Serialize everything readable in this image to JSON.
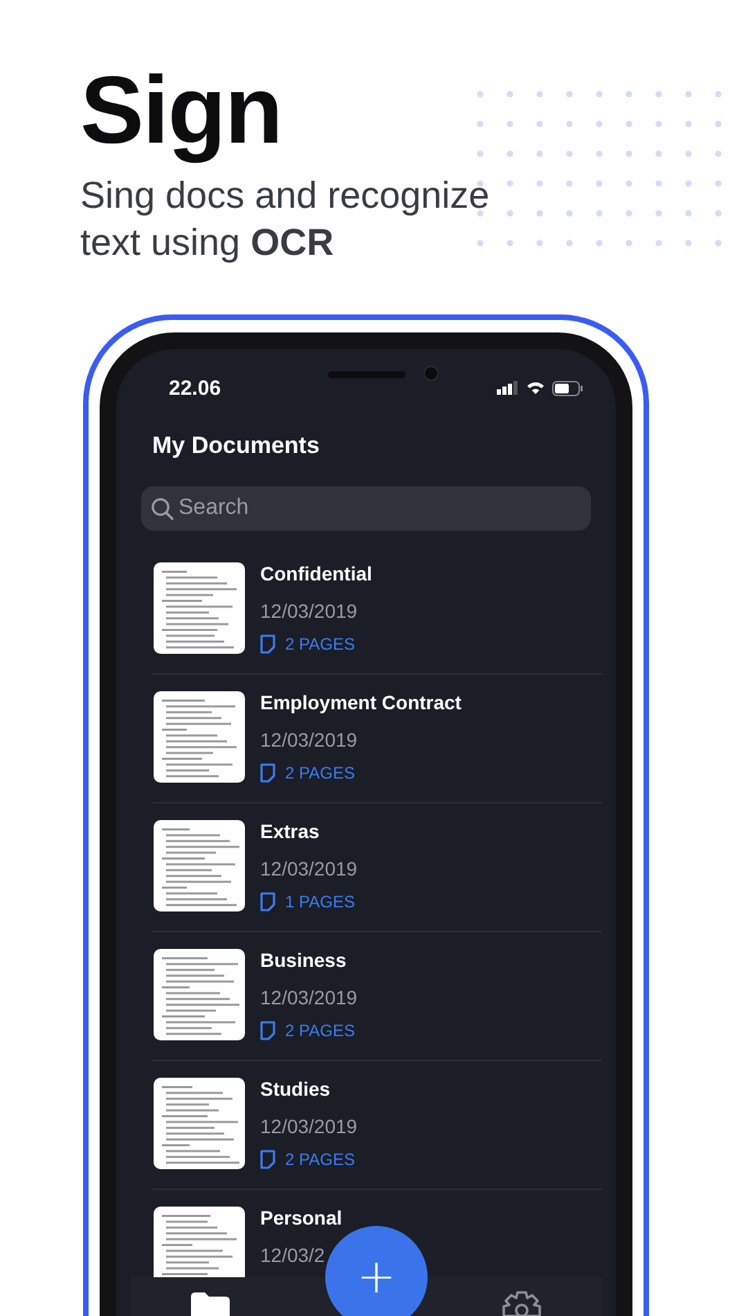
{
  "headline": {
    "title": "Sign",
    "subtitle": "Sing docs and recognize text using **OCR**"
  },
  "phone": {
    "status_bar": {
      "time": "22.06"
    },
    "screen_title": "My Documents",
    "search": {
      "placeholder": "Search"
    },
    "documents": [
      {
        "name": "Confidential",
        "date": "12/03/2019",
        "pages": "2 PAGES"
      },
      {
        "name": "Employment Contract",
        "date": "12/03/2019",
        "pages": "2 PAGES"
      },
      {
        "name": "Extras",
        "date": "12/03/2019",
        "pages": "1 PAGES"
      },
      {
        "name": "Business",
        "date": "12/03/2019",
        "pages": "2 PAGES"
      },
      {
        "name": "Studies",
        "date": "12/03/2019",
        "pages": "2 PAGES"
      },
      {
        "name": "Personal",
        "date": "12/03/2"
      }
    ],
    "add_button": "+"
  }
}
